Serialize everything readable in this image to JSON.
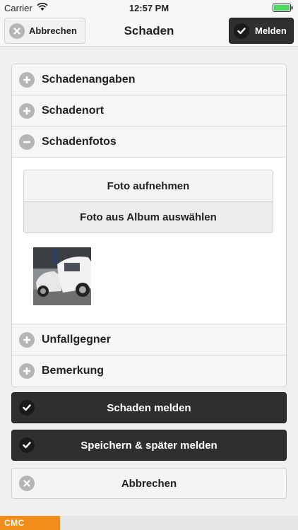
{
  "status_bar": {
    "carrier": "Carrier",
    "time": "12:57 PM",
    "wifi_icon": "wifi-icon",
    "battery_icon": "battery-icon"
  },
  "nav": {
    "cancel_label": "Abbrechen",
    "title": "Schaden",
    "report_label": "Melden"
  },
  "accordion": {
    "sections": [
      {
        "label": "Schadenangaben",
        "icon": "plus-circle-icon",
        "expanded": false
      },
      {
        "label": "Schadenort",
        "icon": "plus-circle-icon",
        "expanded": false
      },
      {
        "label": "Schadenfotos",
        "icon": "minus-circle-icon",
        "expanded": true
      },
      {
        "label": "Unfallgegner",
        "icon": "plus-circle-icon",
        "expanded": false
      },
      {
        "label": "Bemerkung",
        "icon": "plus-circle-icon",
        "expanded": false
      }
    ],
    "photos": {
      "take_photo_label": "Foto aufnehmen",
      "choose_album_label": "Foto aus Album auswählen"
    }
  },
  "actions": {
    "report_damage_label": "Schaden melden",
    "save_later_label": "Speichern & später melden",
    "cancel_label": "Abbrechen"
  },
  "footer": {
    "brand": "CMC"
  },
  "colors": {
    "dark_button": "#2f2f2f",
    "brand_orange": "#f28c1b",
    "battery_green": "#4cd964"
  }
}
